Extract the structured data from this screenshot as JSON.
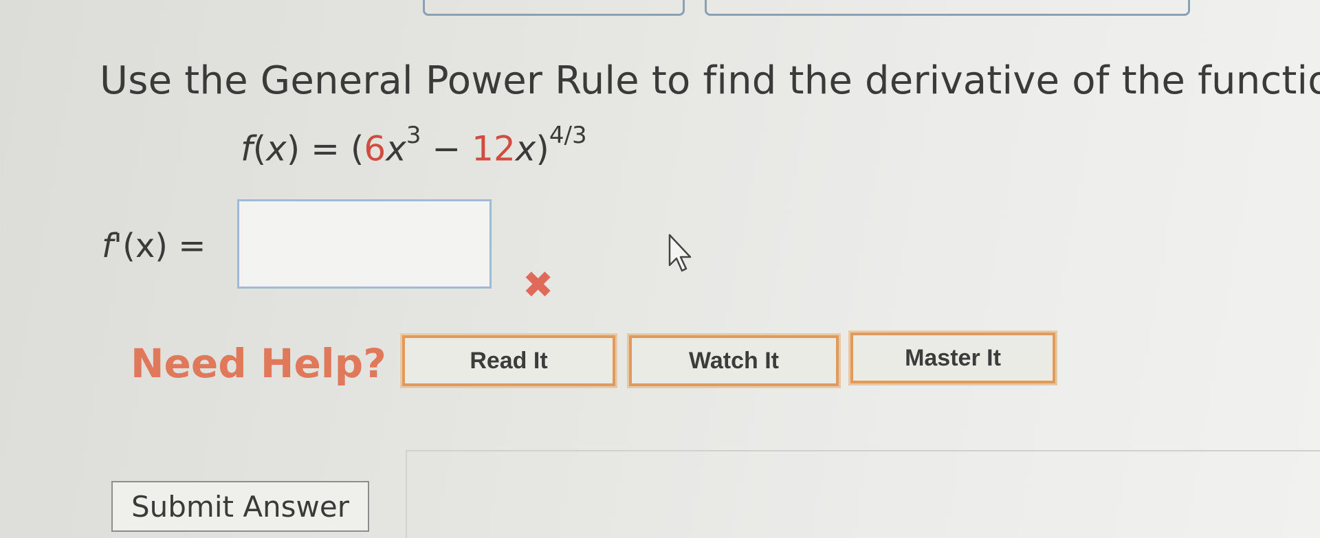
{
  "question": {
    "instruction": "Use the General Power Rule to find the derivative of the function.",
    "function": {
      "name": "f",
      "variable": "x",
      "coef": "6",
      "exp1": "3",
      "minus": "12",
      "outer_exp": "4/3"
    },
    "answer_label_prefix": "f",
    "answer_label_suffix": "'(x) =",
    "answer_value": "",
    "status": "incorrect"
  },
  "help": {
    "label": "Need Help?",
    "buttons": [
      "Read It",
      "Watch It",
      "Master It"
    ]
  },
  "submit": {
    "label": "Submit Answer"
  },
  "colors": {
    "need_help": "#e0785a",
    "button_border": "#e09a5c",
    "error_mark": "#e06a5a",
    "input_border": "#9fbad4"
  },
  "icons": {
    "error": "x-mark-icon",
    "cursor": "mouse-pointer-icon"
  }
}
